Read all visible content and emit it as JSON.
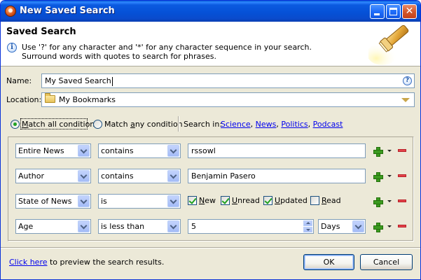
{
  "window": {
    "title": "New Saved Search",
    "controls": [
      "minimize-icon",
      "maximize-icon",
      "close-icon"
    ],
    "close_glyph": "✕"
  },
  "header": {
    "title": "Saved Search",
    "description_line1": "Use '?' for any character and '*' for any character sequence in your search.",
    "description_line2": "Surround words with quotes to search for phrases.",
    "info_glyph": "i"
  },
  "form": {
    "name_label": "Name:",
    "name_value": "My Saved Search",
    "help_glyph": "?",
    "location_label": "Location:",
    "location_value": "My Bookmarks"
  },
  "match": {
    "all_prefix": "",
    "all_label_u": "M",
    "all_label_rest": "atch all conditions",
    "any_label_pre": "Match ",
    "any_label_u": "a",
    "any_label_rest": "ny condition",
    "selected": "all",
    "search_in_label": "Search in:",
    "search_in_links": [
      "Science",
      "News",
      "Politics",
      "Podcast"
    ],
    "search_in_separator": ","
  },
  "conditions": [
    {
      "field": "Entire News",
      "operator": "contains",
      "value": "rssowl"
    },
    {
      "field": "Author",
      "operator": "contains",
      "value": "Benjamin Pasero"
    },
    {
      "field": "State of News",
      "operator": "is",
      "states": [
        {
          "label_u": "N",
          "label_rest": "ew",
          "checked": true
        },
        {
          "label_u": "U",
          "label_rest": "nread",
          "checked": true
        },
        {
          "label_u": "U",
          "label_rest": "pdated",
          "checked": true
        },
        {
          "label_u": "R",
          "label_rest": "ead",
          "checked": false
        }
      ]
    },
    {
      "field": "Age",
      "operator": "is less than",
      "value": "5",
      "unit": "Days"
    }
  ],
  "footer": {
    "preview_link": "Click here",
    "preview_text": " to preview the search results.",
    "ok_label": "OK",
    "cancel_label": "Cancel"
  },
  "colors": {
    "titlebar": "#0550d6",
    "window_bg": "#ece9d8",
    "link": "#0000ee",
    "add_green": "#3b9a1f",
    "remove_red": "#e5434b"
  }
}
